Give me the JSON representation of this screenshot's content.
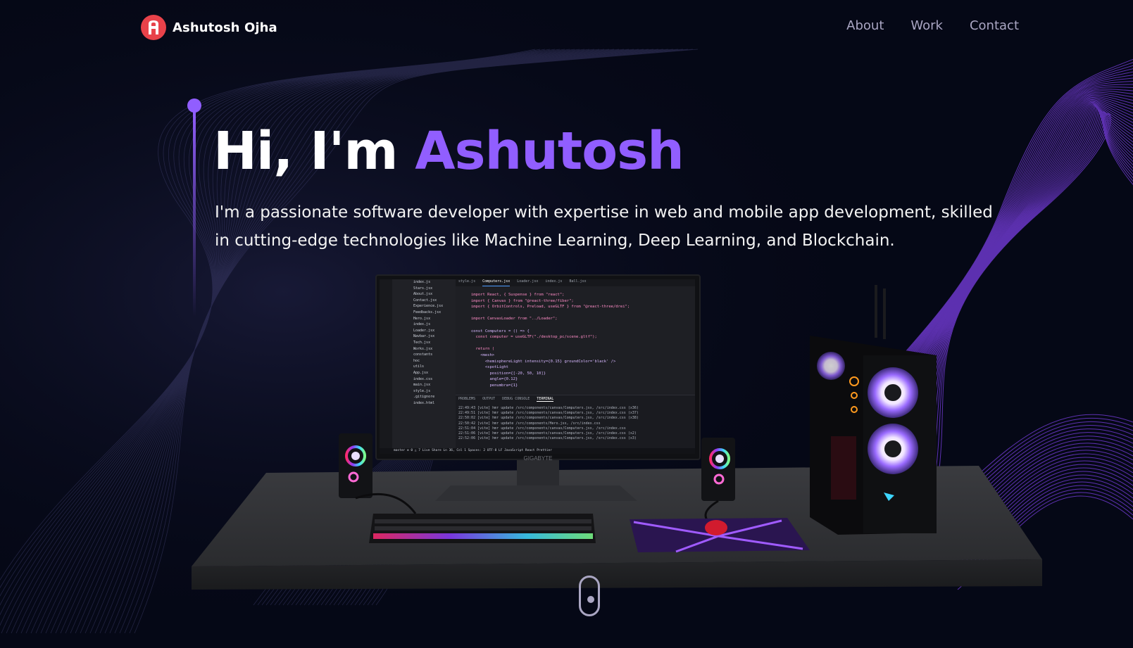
{
  "nav": {
    "logo_icon": "A-logo-icon",
    "brand_name": "Ashutosh Ojha",
    "links": [
      {
        "label": "About"
      },
      {
        "label": "Work"
      },
      {
        "label": "Contact"
      }
    ]
  },
  "hero": {
    "title_prefix": "Hi, I'm ",
    "title_name": "Ashutosh",
    "subtitle": "I'm a passionate software developer with expertise in web and mobile app development, skilled in cutting-edge technologies like Machine Learning, Deep Learning, and Blockchain."
  },
  "scene": {
    "monitor_brand": "GIGABYTE",
    "ide": {
      "tabs": [
        "style.js",
        "Computers.jsx",
        "Loader.jsx",
        "index.js",
        "Ball.jsx"
      ],
      "explorer_items": [
        "index.js",
        "Stars.jsx",
        "About.jsx",
        "Contact.jsx",
        "Experience.jsx",
        "Feedbacks.jsx",
        "Hero.jsx",
        "index.js",
        "Loader.jsx",
        "Navbar.jsx",
        "Tech.jsx",
        "Works.jsx",
        "constants",
        "hoc",
        "utils",
        "App.jsx",
        "index.css",
        "main.jsx",
        "style.js",
        ".gitignore",
        "index.html"
      ],
      "code_lines": [
        "import React, { Suspense } from \"react\";",
        "import { Canvas } from \"@react-three/fiber\";",
        "import { OrbitControls, Preload, useGLTF } from \"@react-three/drei\";",
        "",
        "import CanvasLoader from \"../Loader\";",
        "",
        "const Computers = () => {",
        "  const computer = useGLTF(\"./desktop_pc/scene.gltf\");",
        "",
        "  return (",
        "    <mesh>",
        "      <hemisphereLight intensity={0.15} groundColor='black' />",
        "      <spotLight",
        "        position={[-20, 50, 10]}",
        "        angle={0.12}",
        "        penumbra={1}"
      ],
      "terminal_tabs": [
        "PROBLEMS",
        "OUTPUT",
        "DEBUG CONSOLE",
        "TERMINAL"
      ],
      "terminal_lines": [
        "22:49:43 [vite] hmr update /src/components/canvas/Computers.jsx, /src/index.css (x36)",
        "22:49:51 [vite] hmr update /src/components/canvas/Computers.jsx, /src/index.css (x37)",
        "22:50:02 [vite] hmr update /src/components/canvas/Computers.jsx, /src/index.css (x38)",
        "22:50:42 [vite] hmr update /src/components/Hero.jsx, /src/index.css",
        "22:51:04 [vite] hmr update /src/components/canvas/Computers.jsx, /src/index.css",
        "22:51:06 [vite] hmr update /src/components/canvas/Computers.jsx, /src/index.css (x2)",
        "22:52:06 [vite] hmr update /src/components/canvas/Computers.jsx, /src/index.css (x3)"
      ],
      "status_bar": "master  ⊗ 0 △ 7   Live Share        Ln 36, Col 1   Spaces: 2   UTF-8   LF   JavaScript React   Prettier"
    }
  },
  "scroll_indicator_icon": "mouse-scroll-icon",
  "colors": {
    "background": "#050816",
    "accent": "#915eff",
    "nav_link": "#aaa6c3",
    "logo": "#e8424a"
  }
}
